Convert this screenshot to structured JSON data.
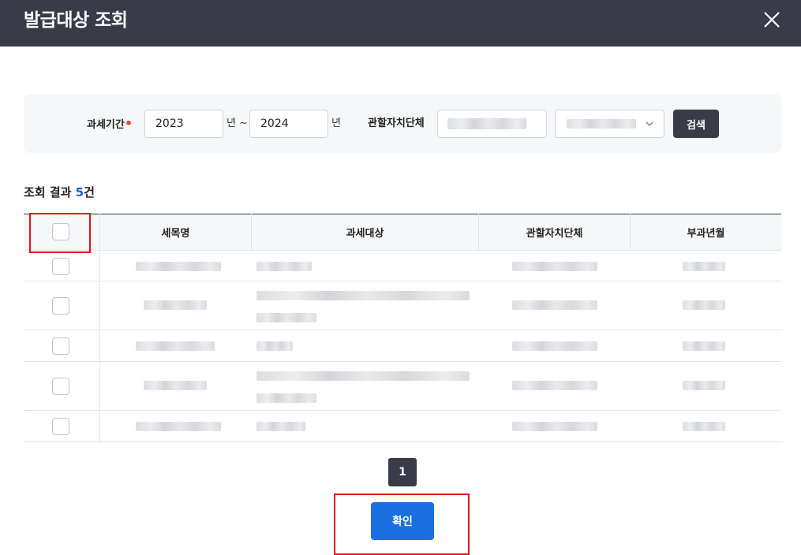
{
  "dialog": {
    "title": "발급대상 조회"
  },
  "search": {
    "period_label": "과세기간",
    "required_mark": "•",
    "year_from": "2023",
    "year_unit_tilde": "년 ~",
    "year_to": "2024",
    "year_unit": "년",
    "authority_label": "관할자치단체",
    "search_button": "검색"
  },
  "result": {
    "label_prefix": "조회 결과 ",
    "count": "5",
    "label_suffix": "건"
  },
  "table": {
    "columns": [
      "세목명",
      "과세대상",
      "관할자치단체",
      "부과년월"
    ]
  },
  "pagination": {
    "current_page": "1"
  },
  "footer": {
    "confirm_button": "확인"
  },
  "colors": {
    "header_bg": "#393b48",
    "primary_blue": "#1b6fe0",
    "count_blue": "#1a5fd6",
    "required_red": "#e8472c",
    "highlight_red": "#e3141a"
  }
}
